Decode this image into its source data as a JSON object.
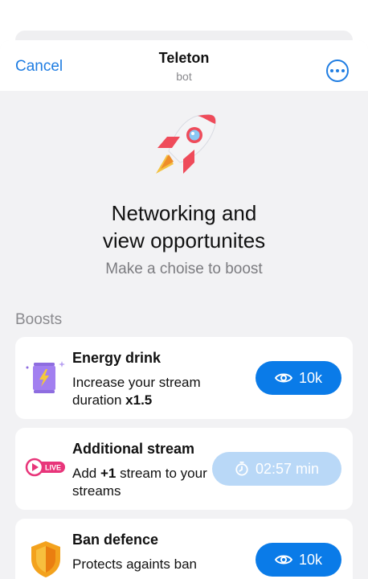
{
  "nav": {
    "cancel_label": "Cancel",
    "title": "Teleton",
    "subtitle": "bot",
    "more_icon": "more-dots-icon"
  },
  "hero": {
    "icon": "rocket-icon",
    "title_line1": "Networking and",
    "title_line2": "view opportunites",
    "subtitle": "Make a choise to boost"
  },
  "boosts": {
    "section_label": "Boosts",
    "items": [
      {
        "icon": "energy-drink-icon",
        "title": "Energy drink",
        "desc_prefix": "Increase your stream duration ",
        "desc_bold": "x1.5",
        "desc_suffix": "",
        "button_icon": "eye-icon",
        "button_label": "10k",
        "button_state": "active"
      },
      {
        "icon": "live-stream-icon",
        "title": "Additional stream",
        "live_badge": "LIVE",
        "desc_prefix": "Add ",
        "desc_bold": "+1",
        "desc_suffix": " stream to your streams",
        "button_icon": "timer-icon",
        "button_label": "02:57 min",
        "button_state": "disabled"
      },
      {
        "icon": "shield-icon",
        "title": "Ban defence",
        "desc_prefix": "Protects againts ban",
        "desc_bold": "",
        "desc_suffix": "",
        "button_icon": "eye-icon",
        "button_label": "10k",
        "button_state": "active"
      }
    ]
  },
  "colors": {
    "accent": "#0a7be8",
    "accent_disabled": "#b9d8f7",
    "background": "#f2f2f4",
    "card": "#ffffff"
  }
}
